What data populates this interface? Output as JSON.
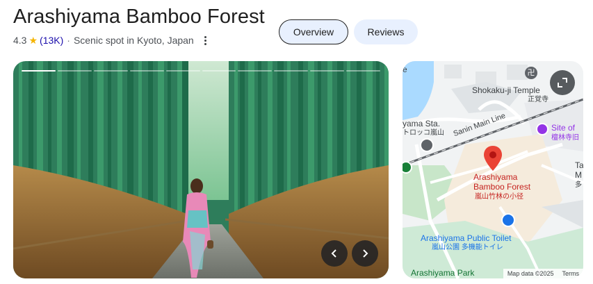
{
  "header": {
    "title": "Arashiyama Bamboo Forest",
    "rating": "4.3",
    "star_icon": "star-icon",
    "review_count": "(13K)",
    "separator": "·",
    "category": "Scenic spot in Kyoto, Japan",
    "more_icon": "more-vert-icon"
  },
  "tabs": [
    {
      "label": "Overview",
      "selected": true
    },
    {
      "label": "Reviews",
      "selected": false
    }
  ],
  "carousel": {
    "slides_total": 10,
    "current_slide": 1,
    "prev_icon": "chevron-left-icon",
    "next_icon": "chevron-right-icon"
  },
  "map": {
    "labels": {
      "temple": "Shokaku-ji Temple",
      "temple_jp": "正覚寺",
      "station": "yama Sta.",
      "station_jp": "トロッコ嵐山",
      "line": "Sanin Main Line",
      "site": "Site of",
      "site_jp": "檀林寺旧",
      "place_line1": "Arashiyama",
      "place_line2": "Bamboo Forest",
      "place_jp": "嵐山竹林の小径",
      "toilet": "Arashiyama Public Toilet",
      "toilet_jp": "嵐山公園 多機能トイレ",
      "park": "Arashiyama Park",
      "edge_t": "Ta",
      "edge_m": "M",
      "edge_jp": "多",
      "edge_left": "e"
    },
    "attribution": "Map data ©2025",
    "terms": "Terms",
    "expand_icon": "expand-icon",
    "colors": {
      "pin": "#ea4335",
      "place_text": "#c5221f",
      "poi_blue": "#1a73e8",
      "poi_purple": "#9334e6"
    }
  }
}
